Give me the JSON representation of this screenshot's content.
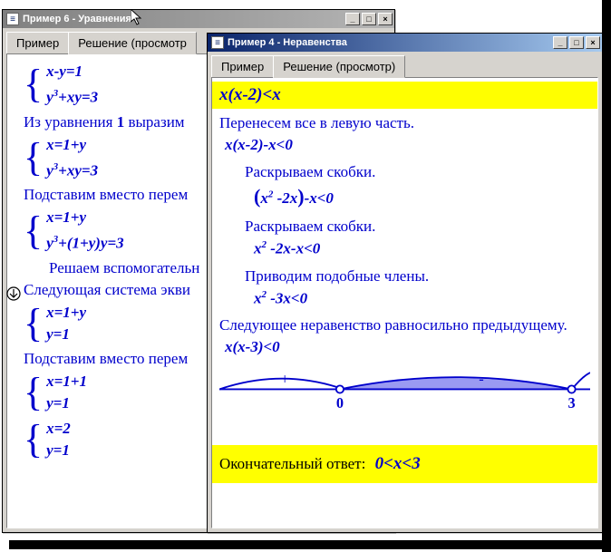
{
  "bg_window": {
    "title": "Пример 6 - Уравнения",
    "tabs": [
      "Пример",
      "Решение (просмотр"
    ],
    "active_tab": 1,
    "lines": [
      {
        "type": "brace",
        "rows": [
          "x-y=1",
          "y³+xy=3"
        ]
      },
      {
        "type": "text",
        "val": "Из уравнения 1 выразим"
      },
      {
        "type": "brace",
        "rows": [
          "x=1+y",
          "y³+xy=3"
        ]
      },
      {
        "type": "text",
        "val": "Подставим вместо перем"
      },
      {
        "type": "brace",
        "rows": [
          "x=1+y",
          "y³+(1+y)y=3"
        ]
      },
      {
        "type": "text",
        "val": "Решаем вспомогательн",
        "indent": true
      },
      {
        "type": "text",
        "val": "Следующая система экви"
      },
      {
        "type": "brace",
        "rows": [
          "x=1+y",
          "y=1"
        ]
      },
      {
        "type": "text",
        "val": "Подставим вместо перем"
      },
      {
        "type": "brace",
        "rows": [
          "x=1+1",
          "y=1"
        ]
      },
      {
        "type": "brace",
        "rows": [
          "x=2",
          "y=1"
        ]
      }
    ]
  },
  "fg_window": {
    "title": "Пример 4 - Неравенства",
    "tabs": [
      "Пример",
      "Решение (просмотр)"
    ],
    "active_tab": 1,
    "problem": "x(x-2)<x",
    "step1_text": "Перенесем все в левую часть.",
    "step1_math": "x(x-2)-x<0",
    "expand1_text": "Раскрываем скобки.",
    "expand1_math": "(x²-2x)-x<0",
    "expand2_text": "Раскрываем скобки.",
    "expand2_math": "x²-2x-x<0",
    "simplify_text": "Приводим подобные члены.",
    "simplify_math": "x²-3x<0",
    "equiv_text": "Следующее неравенство равносильно предыдущему.",
    "equiv_math": "x(x-3)<0",
    "plot": {
      "marks": [
        "0",
        "3"
      ],
      "signs": [
        "+",
        "-"
      ]
    },
    "answer_label": "Окончательный ответ:",
    "answer_math": "0<x<3"
  },
  "chart_data": {
    "type": "line",
    "description": "sign chart (number line) for x(x-3)<0",
    "critical_points": [
      0,
      3
    ],
    "intervals": [
      {
        "range": "(-inf,0)",
        "sign": "+",
        "shaded": false
      },
      {
        "range": "(0,3)",
        "sign": "-",
        "shaded": true
      },
      {
        "range": "(3,+inf)",
        "sign": "",
        "shaded": false
      }
    ],
    "x_ticks": [
      0,
      3
    ]
  }
}
